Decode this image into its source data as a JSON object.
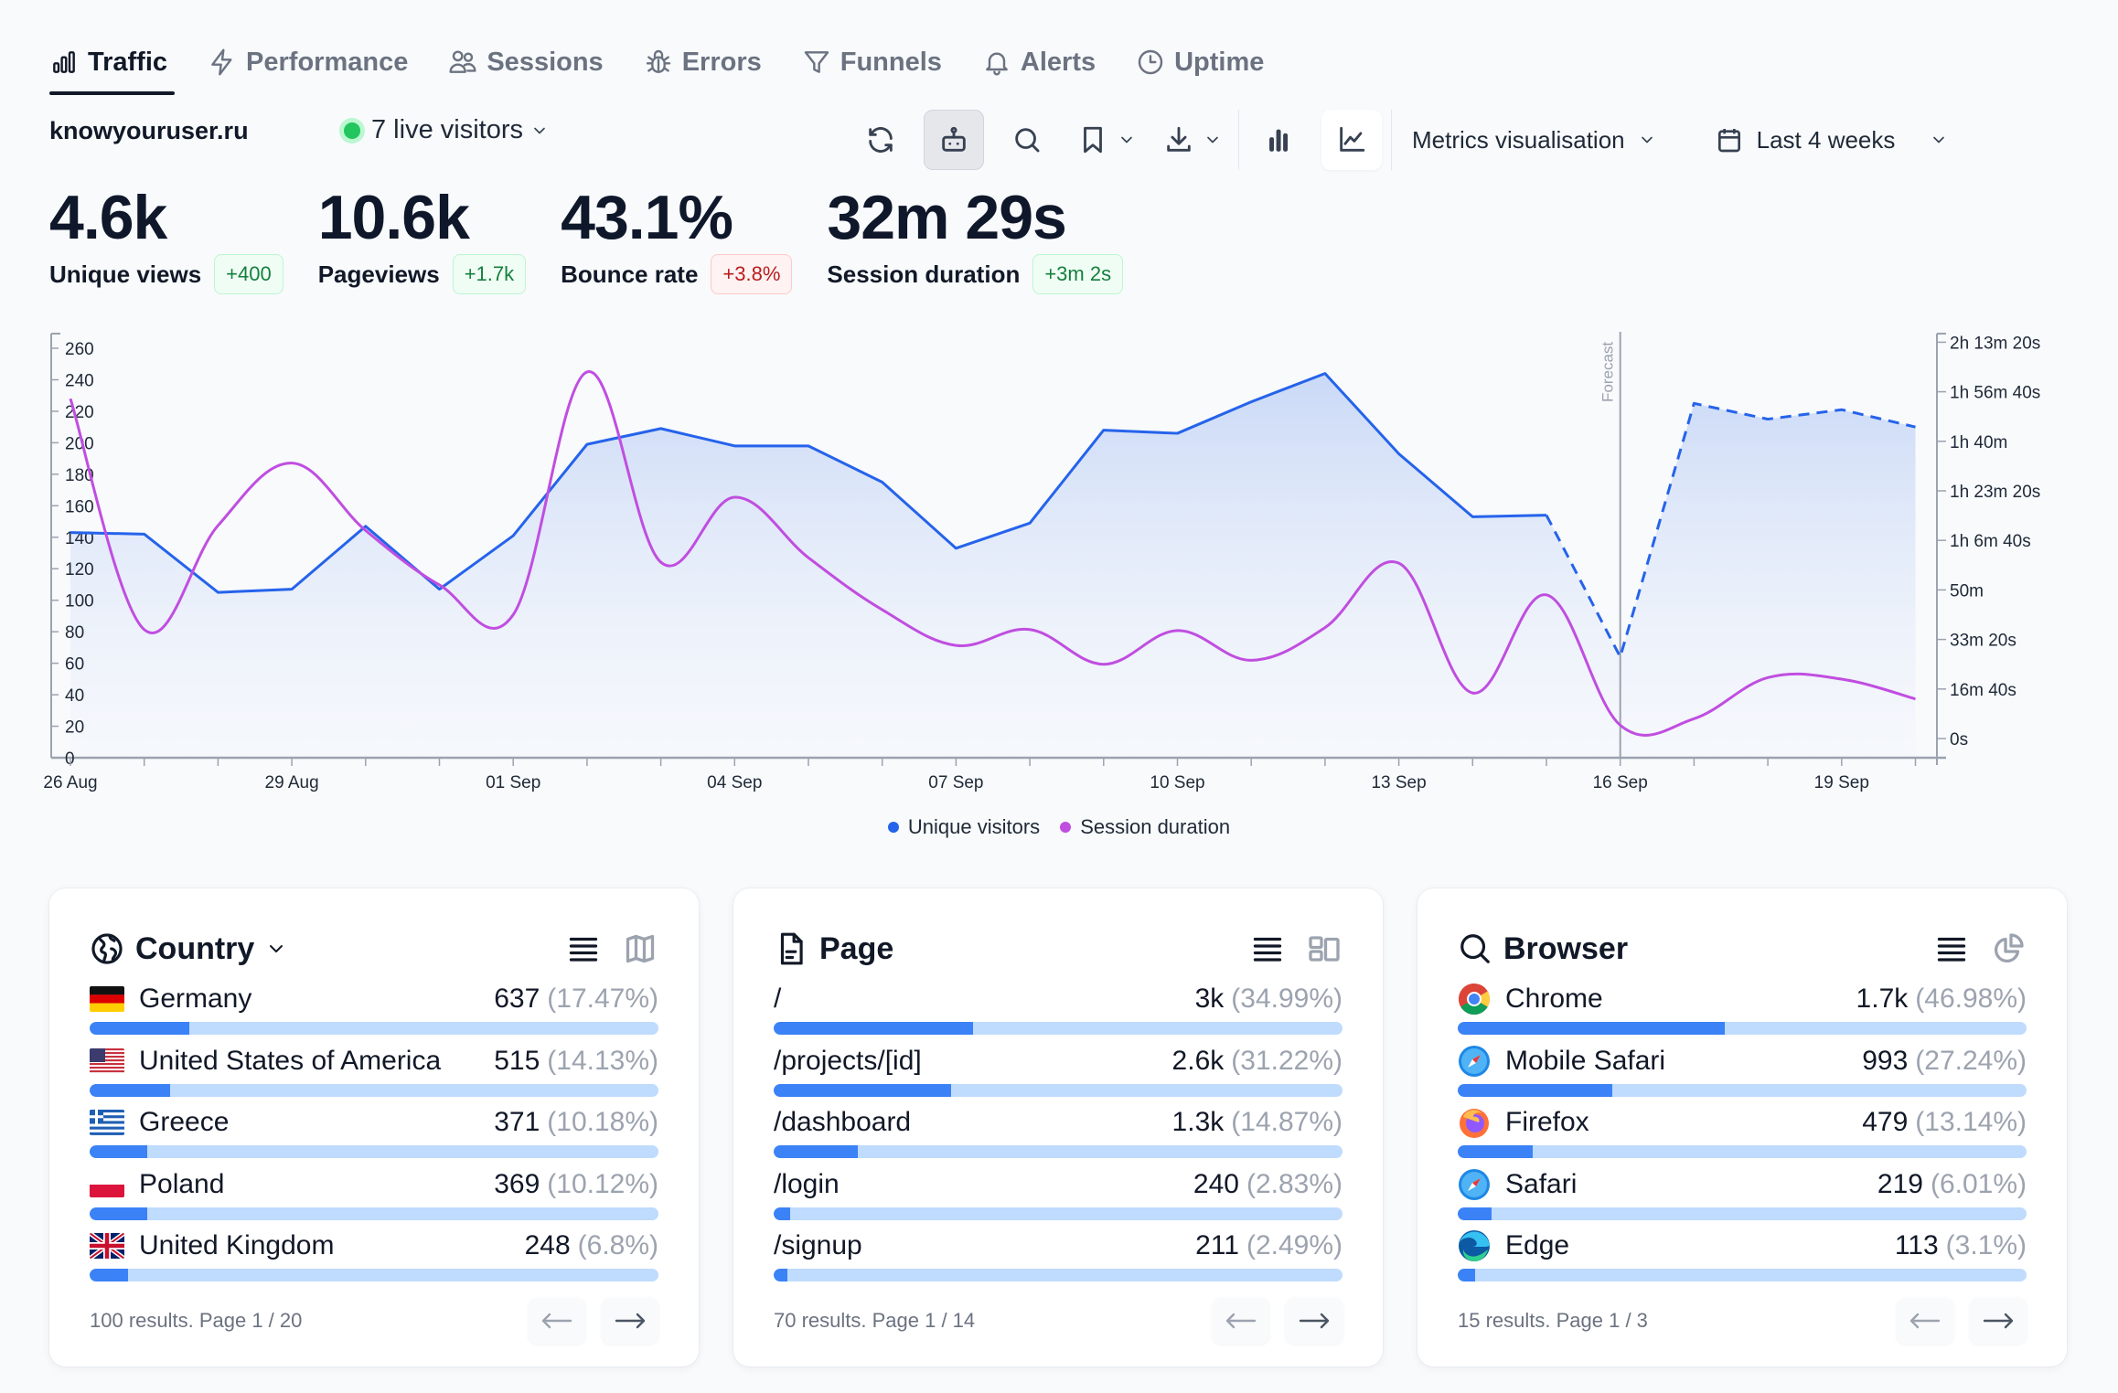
{
  "tabs": [
    {
      "label": "Traffic",
      "icon": "bar-chart-icon",
      "active": true
    },
    {
      "label": "Performance",
      "icon": "lightning-icon",
      "active": false
    },
    {
      "label": "Sessions",
      "icon": "users-icon",
      "active": false
    },
    {
      "label": "Errors",
      "icon": "bug-icon",
      "active": false
    },
    {
      "label": "Funnels",
      "icon": "funnel-icon",
      "active": false
    },
    {
      "label": "Alerts",
      "icon": "bell-icon",
      "active": false
    },
    {
      "label": "Uptime",
      "icon": "clock-icon",
      "active": false
    }
  ],
  "site": "knowyouruser.ru",
  "live": {
    "label": "7 live visitors",
    "status_color": "#22c55e"
  },
  "toolbar": {
    "refresh": "refresh-icon",
    "bot": "robot-icon",
    "search": "search-icon",
    "bookmark": "bookmark-icon",
    "download": "download-icon",
    "bar_mode": "bar-chart-icon",
    "line_mode": "line-chart-icon",
    "metrics_select": "Metrics visualisation",
    "period_select": "Last 4 weeks"
  },
  "metrics": [
    {
      "value": "4.6k",
      "label": "Unique views",
      "delta": "+400",
      "trend": "positive"
    },
    {
      "value": "10.6k",
      "label": "Pageviews",
      "delta": "+1.7k",
      "trend": "positive"
    },
    {
      "value": "43.1%",
      "label": "Bounce rate",
      "delta": "+3.8%",
      "trend": "negative"
    },
    {
      "value": "32m 29s",
      "label": "Session duration",
      "delta": "+3m 2s",
      "trend": "positive"
    }
  ],
  "chart_data": {
    "type": "line",
    "title": "",
    "x": [
      "26 Aug",
      "27 Aug",
      "28 Aug",
      "29 Aug",
      "30 Aug",
      "31 Aug",
      "01 Sep",
      "02 Sep",
      "03 Sep",
      "04 Sep",
      "05 Sep",
      "06 Sep",
      "07 Sep",
      "08 Sep",
      "09 Sep",
      "10 Sep",
      "11 Sep",
      "12 Sep",
      "13 Sep",
      "14 Sep",
      "15 Sep",
      "16 Sep",
      "17 Sep",
      "18 Sep",
      "19 Sep",
      "20 Sep"
    ],
    "x_tick_labels": [
      "26 Aug",
      "29 Aug",
      "01 Sep",
      "04 Sep",
      "07 Sep",
      "10 Sep",
      "13 Sep",
      "16 Sep",
      "19 Sep"
    ],
    "forecast_start": "16 Sep",
    "forecast_label": "Forecast",
    "series": [
      {
        "name": "Unique visitors",
        "axis": "left",
        "color": "#2563eb",
        "style": "area",
        "forecast_from_index": 20,
        "values": [
          143,
          142,
          105,
          107,
          147,
          107,
          141,
          199,
          209,
          198,
          198,
          175,
          133,
          149,
          208,
          206,
          226,
          244,
          193,
          153,
          154,
          64,
          225,
          215,
          221,
          210
        ]
      },
      {
        "name": "Session duration",
        "axis": "right",
        "color": "#c04ee0",
        "style": "smooth",
        "unit": "seconds",
        "values": [
          6860,
          2200,
          4300,
          5560,
          4200,
          3100,
          2500,
          7400,
          3560,
          4870,
          3650,
          2600,
          1880,
          2200,
          1500,
          2180,
          1580,
          2240,
          3540,
          920,
          2900,
          270,
          400,
          1230,
          1200,
          800
        ]
      }
    ],
    "y_left": {
      "min": 0,
      "max": 260,
      "ticks": [
        "0",
        "20",
        "40",
        "60",
        "80",
        "100",
        "120",
        "140",
        "160",
        "180",
        "200",
        "220",
        "240",
        "260"
      ]
    },
    "y_right": {
      "min": 0,
      "max": 8000,
      "ticks": [
        "0s",
        "16m 40s",
        "33m 20s",
        "50m",
        "1h 6m 40s",
        "1h 23m 20s",
        "1h 40m",
        "1h 56m 40s",
        "2h 13m 20s"
      ]
    },
    "legend": [
      "Unique visitors",
      "Session duration"
    ],
    "legend_position": "bottom",
    "grid": false
  },
  "cards": [
    {
      "title": "Country",
      "title_icon": "globe-icon",
      "has_dropdown": true,
      "alt_view_icon": "map-icon",
      "rows": [
        {
          "name": "Germany",
          "flag": "de",
          "value": "637",
          "pct": "(17.47%)",
          "share": 17.47
        },
        {
          "name": "United States of America",
          "flag": "us",
          "value": "515",
          "pct": "(14.13%)",
          "share": 14.13
        },
        {
          "name": "Greece",
          "flag": "gr",
          "value": "371",
          "pct": "(10.18%)",
          "share": 10.18
        },
        {
          "name": "Poland",
          "flag": "pl",
          "value": "369",
          "pct": "(10.12%)",
          "share": 10.12
        },
        {
          "name": "United Kingdom",
          "flag": "gb",
          "value": "248",
          "pct": "(6.8%)",
          "share": 6.8
        }
      ],
      "footer": "100 results. Page 1 / 20"
    },
    {
      "title": "Page",
      "title_icon": "file-icon",
      "has_dropdown": false,
      "alt_view_icon": "layout-icon",
      "rows": [
        {
          "name": "/",
          "value": "3k",
          "pct": "(34.99%)",
          "share": 34.99
        },
        {
          "name": "/projects/[id]",
          "value": "2.6k",
          "pct": "(31.22%)",
          "share": 31.22
        },
        {
          "name": "/dashboard",
          "value": "1.3k",
          "pct": "(14.87%)",
          "share": 14.87
        },
        {
          "name": "/login",
          "value": "240",
          "pct": "(2.83%)",
          "share": 2.83
        },
        {
          "name": "/signup",
          "value": "211",
          "pct": "(2.49%)",
          "share": 2.49
        }
      ],
      "footer": "70 results. Page 1 / 14"
    },
    {
      "title": "Browser",
      "title_icon": "search-icon",
      "has_dropdown": false,
      "alt_view_icon": "pie-chart-icon",
      "rows": [
        {
          "name": "Chrome",
          "icon": "chrome",
          "value": "1.7k",
          "pct": "(46.98%)",
          "share": 46.98
        },
        {
          "name": "Mobile Safari",
          "icon": "safari",
          "value": "993",
          "pct": "(27.24%)",
          "share": 27.24
        },
        {
          "name": "Firefox",
          "icon": "firefox",
          "value": "479",
          "pct": "(13.14%)",
          "share": 13.14
        },
        {
          "name": "Safari",
          "icon": "safari",
          "value": "219",
          "pct": "(6.01%)",
          "share": 6.01
        },
        {
          "name": "Edge",
          "icon": "edge",
          "value": "113",
          "pct": "(3.1%)",
          "share": 3.1
        }
      ],
      "footer": "15 results. Page 1 / 3"
    }
  ]
}
